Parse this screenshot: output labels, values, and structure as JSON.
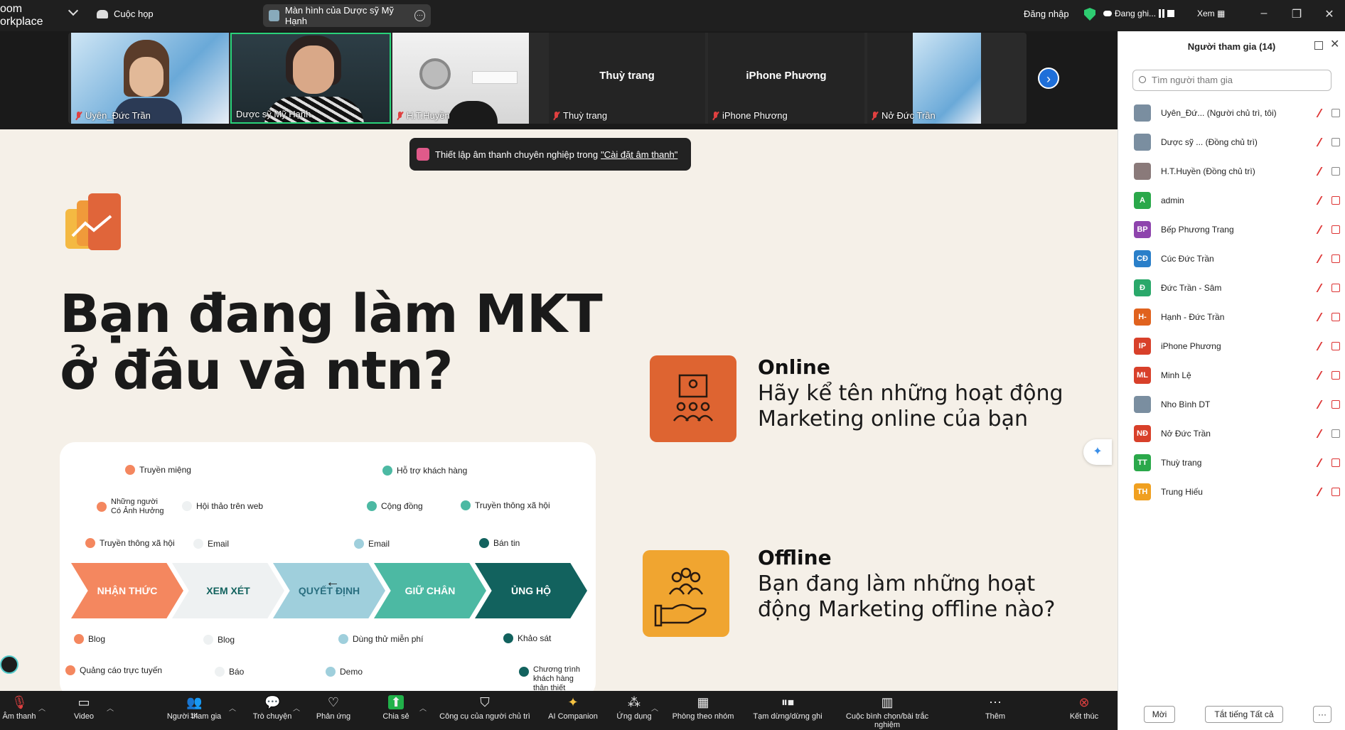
{
  "app": {
    "brand": "oom\norkplace",
    "meeting_label": "Cuộc họp",
    "share_title": "Màn hình của Dược sỹ Mỹ Hạnh",
    "login": "Đăng nhập",
    "recording": "Đang ghi...",
    "view": "Xem"
  },
  "gallery": [
    {
      "name": "Uyên_Đức Trần",
      "has_video": true
    },
    {
      "name": "Dược sỹ Mỹ Hạnh",
      "has_video": true,
      "active": true
    },
    {
      "name": "H.T.Huyền",
      "has_video": true
    },
    {
      "name": "Thuỳ trang",
      "center": "Thuỳ trang"
    },
    {
      "name": "iPhone Phương",
      "center": "iPhone Phương"
    },
    {
      "name": "Nở Đức Trần",
      "has_video": true
    }
  ],
  "toast": {
    "text": "Thiết lập âm thanh chuyên nghiệp trong ",
    "link": "\"Cài đặt âm thanh\""
  },
  "slide": {
    "headline_1": "Bạn đang làm MKT",
    "headline_2": "ở đâu và ntn?",
    "online_title": "Online",
    "online_text": "Hãy kể tên những hoạt động Marketing online của bạn",
    "offline_title": "Offline",
    "offline_text": "Bạn đang làm những hoạt động Marketing offline nào?",
    "funnel": [
      "NHẬN THỨC",
      "XEM XÉT",
      "QUYẾT ĐỊNH",
      "GIỮ CHÂN",
      "ỦNG HỘ"
    ],
    "labels": {
      "l1": "Truyền miệng",
      "l2": "Hỗ trợ khách hàng",
      "l3": "Những người\nCó Ảnh Hưởng",
      "l4": "Hội thảo trên web",
      "l5": "Cộng đồng",
      "l6": "Truyền thông xã hội",
      "l7": "Truyền thông xã hội",
      "l8": "Email",
      "l9": "Email",
      "l10": "Bán tin",
      "l11": "Blog",
      "l12": "Blog",
      "l13": "Dùng thử miễn phí",
      "l14": "Khảo sát",
      "l15": "Quảng cáo trực tuyến",
      "l16": "Báo",
      "l17": "Demo",
      "l18": "Chương trình\nkhách hàng\nthân thiết"
    },
    "colors": {
      "orange": "#f4875f",
      "pale": "#eef1f2",
      "lightblue": "#9fcfdc",
      "teal": "#4cb9a3",
      "dark": "#12625e"
    }
  },
  "participants": {
    "title": "Người tham gia (14)",
    "search_placeholder": "Tìm người tham gia",
    "list": [
      {
        "initials": "",
        "name": "Uyên_Đứ...  (Người chủ trì, tôi)",
        "color": "#7a8ea0"
      },
      {
        "initials": "",
        "name": "Dược sỹ ...  (Đồng chủ trì)",
        "color": "#7a8ea0"
      },
      {
        "initials": "",
        "name": "H.T.Huyền (Đồng chủ trì)",
        "color": "#8a7a7a"
      },
      {
        "initials": "A",
        "name": "admin",
        "color": "#2aa84a"
      },
      {
        "initials": "BP",
        "name": "Bếp Phương Trang",
        "color": "#8e44ad"
      },
      {
        "initials": "CĐ",
        "name": "Cúc Đức Trần",
        "color": "#2a7fc9"
      },
      {
        "initials": "Đ",
        "name": "Đức Trần - Sâm",
        "color": "#2aa86a"
      },
      {
        "initials": "H-",
        "name": "Hạnh - Đức Trần",
        "color": "#e0621e"
      },
      {
        "initials": "IP",
        "name": "iPhone Phương",
        "color": "#d8402a"
      },
      {
        "initials": "ML",
        "name": "Minh Lệ",
        "color": "#d8402a"
      },
      {
        "initials": "",
        "name": "Nho Bình DT",
        "color": "#7a8ea0"
      },
      {
        "initials": "NĐ",
        "name": "Nở Đức Trần",
        "color": "#d8402a"
      },
      {
        "initials": "TT",
        "name": "Thuỳ trang",
        "color": "#2aa84a"
      },
      {
        "initials": "TH",
        "name": "Trung Hiếu",
        "color": "#f0a020"
      }
    ],
    "invite": "Mời",
    "mute_all": "Tắt tiếng Tất cả"
  },
  "toolbar": {
    "audio": "Âm thanh",
    "video": "Video",
    "participants": "Người tham gia",
    "participants_count": "14",
    "chat": "Trò chuyện",
    "react": "Phản ứng",
    "share": "Chia sẻ",
    "host_tools": "Công cụ của người chủ trì",
    "companion": "AI Companion",
    "apps": "Ứng dụng",
    "rooms": "Phòng theo nhóm",
    "pause_rec": "Tạm dừng/dừng ghi",
    "poll": "Cuộc bình chọn/bài trắc nghiệm",
    "more": "Thêm",
    "end": "Kết thúc"
  }
}
